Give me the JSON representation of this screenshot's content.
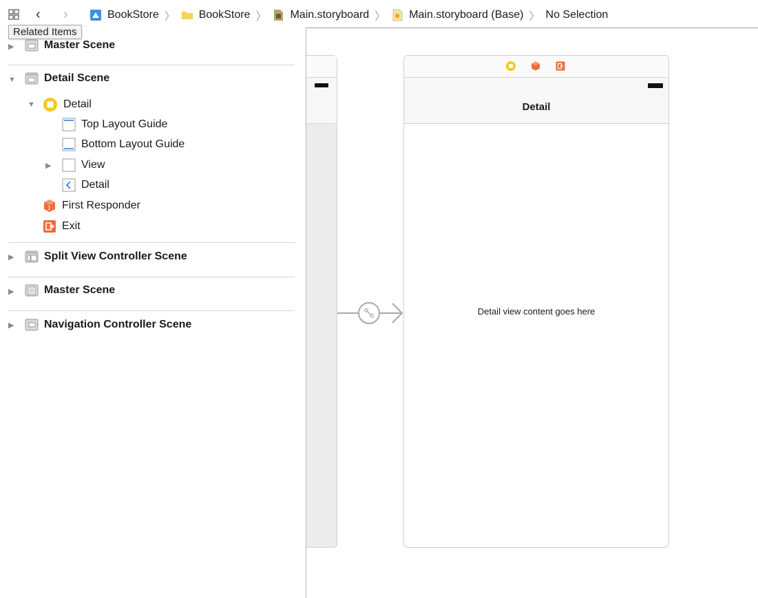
{
  "jumpbar": {
    "related_items_tooltip": "Related Items",
    "breadcrumbs": [
      {
        "label": "BookStore",
        "icon": "project-icon"
      },
      {
        "label": "BookStore",
        "icon": "folder-icon"
      },
      {
        "label": "Main.storyboard",
        "icon": "storyboard-icon"
      },
      {
        "label": "Main.storyboard (Base)",
        "icon": "localized-storyboard-icon"
      },
      {
        "label": "No Selection",
        "icon": ""
      }
    ]
  },
  "outline": {
    "master_scene_top": "Master Scene",
    "detail_scene": {
      "label": "Detail Scene",
      "controller": "Detail",
      "children": [
        "Top Layout Guide",
        "Bottom Layout Guide",
        "View",
        "Detail"
      ],
      "first_responder": "First Responder",
      "exit": "Exit"
    },
    "other_scenes": [
      "Split View Controller Scene",
      "Master Scene",
      "Navigation Controller Scene"
    ]
  },
  "canvas": {
    "detail_nav_title": "Detail",
    "detail_content_label": "Detail view content goes here"
  },
  "colors": {
    "accent_orange": "#ef6d3b",
    "controller_yellow": "#f6c624",
    "back_blue": "#2f7cf6",
    "folder_yellow": "#f5c949"
  }
}
